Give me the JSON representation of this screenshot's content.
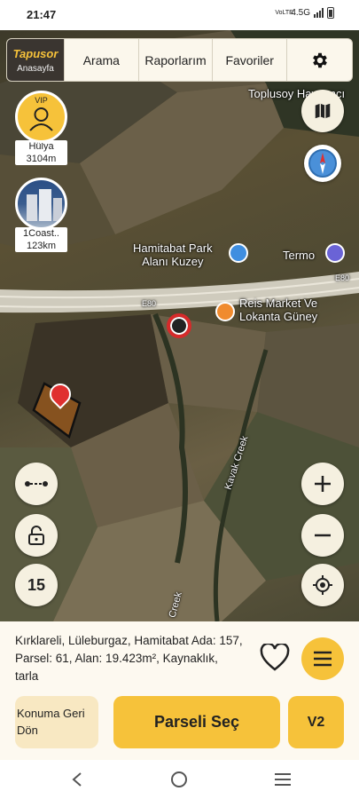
{
  "status": {
    "time": "21:47",
    "network": "4.5G",
    "volte": "VoLTE"
  },
  "nav": {
    "brand": "Tapusor",
    "home": "Anasayfa",
    "items": [
      "Arama",
      "Raporlarım",
      "Favoriler"
    ]
  },
  "avatars": [
    {
      "label": "Hülya",
      "distance": "3104m",
      "badge": "VIP"
    },
    {
      "label": "1Coast..",
      "distance": "123km"
    }
  ],
  "map_labels": {
    "top_right": "Toplusoy Hayvancı",
    "park": "Hamitabat Park\nAlanı Kuzey",
    "termo": "Termo",
    "road1": "E80",
    "road2": "E80",
    "market": "Reis Market Ve\nLokanta Güney",
    "creek": "Kavak Creek",
    "creek2": "Creek"
  },
  "zoom_level": "15",
  "address": "Kırklareli, Lüleburgaz, Hamitabat Ada: 157, Parsel: 61, Alan: 19.423m², Kaynaklık, tarla",
  "buttons": {
    "back_to_location": "Konuma Geri Dön",
    "select_parcel": "Parseli Seç",
    "v2": "V2"
  },
  "colors": {
    "accent": "#f6c23a",
    "panel": "#fdf9f0",
    "parcel": "#9a5a1e"
  }
}
